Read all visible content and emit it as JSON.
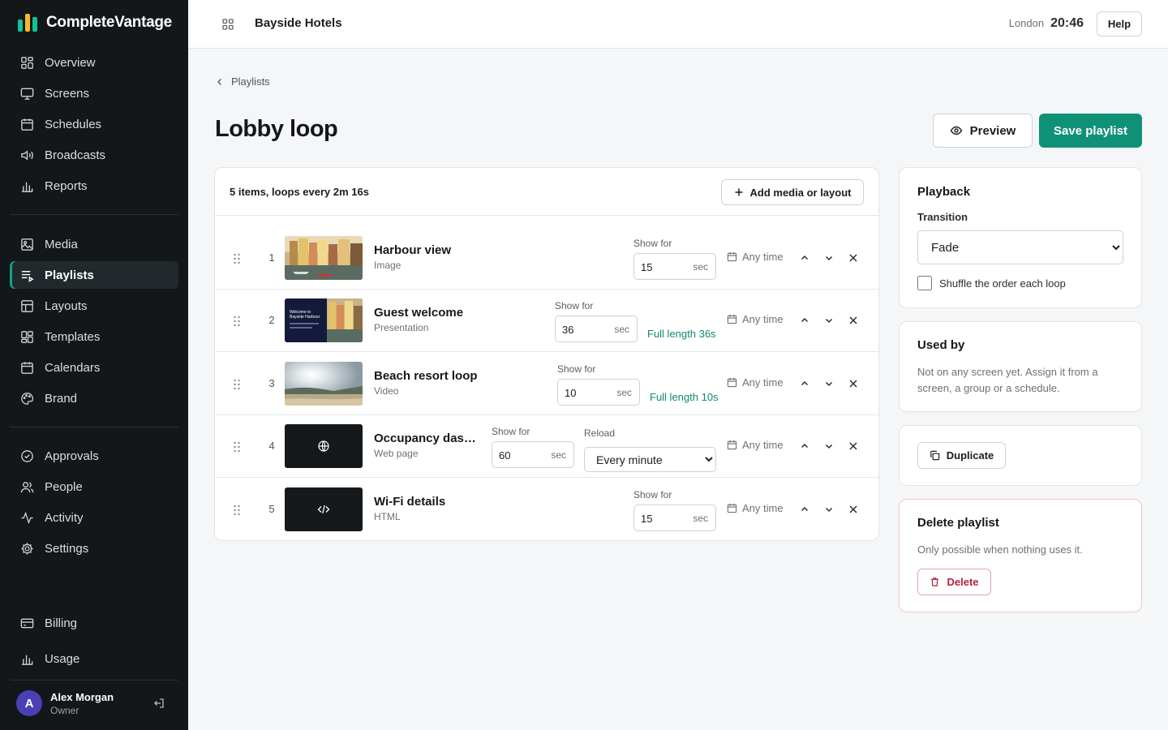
{
  "app": {
    "name": "CompleteVantage",
    "logo_colors": [
      "#12c29a",
      "#f5b82e",
      "#12c29a"
    ]
  },
  "sidebar": {
    "primary": [
      {
        "label": "Overview",
        "icon": "grid-icon"
      },
      {
        "label": "Screens",
        "icon": "monitor-icon"
      },
      {
        "label": "Schedules",
        "icon": "calendar-icon"
      },
      {
        "label": "Broadcasts",
        "icon": "speaker-icon"
      },
      {
        "label": "Reports",
        "icon": "bar-chart-icon"
      }
    ],
    "content": [
      {
        "label": "Media",
        "icon": "image-icon"
      },
      {
        "label": "Playlists",
        "icon": "playlist-icon",
        "active": true
      },
      {
        "label": "Layouts",
        "icon": "layout-icon"
      },
      {
        "label": "Templates",
        "icon": "template-icon"
      },
      {
        "label": "Calendars",
        "icon": "calendar-icon"
      },
      {
        "label": "Brand",
        "icon": "palette-icon"
      }
    ],
    "admin": [
      {
        "label": "Approvals",
        "icon": "check-circle-icon"
      },
      {
        "label": "People",
        "icon": "users-icon"
      },
      {
        "label": "Activity",
        "icon": "activity-icon"
      },
      {
        "label": "Settings",
        "icon": "gear-icon"
      }
    ],
    "billing": [
      {
        "label": "Billing",
        "icon": "credit-card-icon"
      },
      {
        "label": "Usage",
        "icon": "bar-chart-icon"
      }
    ],
    "user": {
      "initial": "A",
      "name": "Alex Morgan",
      "role": "Owner"
    }
  },
  "topbar": {
    "org_name": "Bayside Hotels",
    "city": "London",
    "time": "20:46",
    "help_label": "Help"
  },
  "page": {
    "breadcrumb": "Playlists",
    "title": "Lobby loop",
    "preview_label": "Preview",
    "save_label": "Save playlist"
  },
  "playlist": {
    "summary": "5 items, loops every 2m 16s",
    "add_label": "Add media or layout",
    "show_for_label": "Show for",
    "unit": "sec",
    "any_time": "Any time",
    "reload_label": "Reload",
    "items": [
      {
        "index": "1",
        "title": "Harbour view",
        "type": "Image",
        "seconds": "15",
        "full_length": "",
        "thumb": "harbour"
      },
      {
        "index": "2",
        "title": "Guest welcome",
        "type": "Presentation",
        "seconds": "36",
        "full_length": "Full length 36s",
        "thumb": "welcome",
        "thumb_text": "Welcome to Bayside Harbour"
      },
      {
        "index": "3",
        "title": "Beach resort loop",
        "type": "Video",
        "seconds": "10",
        "full_length": "Full length 10s",
        "thumb": "beach"
      },
      {
        "index": "4",
        "title": "Occupancy dashboard",
        "type": "Web page",
        "seconds": "60",
        "full_length": "",
        "thumb": "globe-icon",
        "reload": "Every minute"
      },
      {
        "index": "5",
        "title": "Wi-Fi details",
        "type": "HTML",
        "seconds": "15",
        "full_length": "",
        "thumb": "code-icon"
      }
    ]
  },
  "playback": {
    "title": "Playback",
    "transition_label": "Transition",
    "transition_value": "Fade",
    "shuffle_label": "Shuffle the order each loop"
  },
  "used_by": {
    "title": "Used by",
    "text": "Not on any screen yet. Assign it from a screen, a group or a schedule."
  },
  "duplicate": {
    "label": "Duplicate"
  },
  "delete": {
    "title": "Delete playlist",
    "text": "Only possible when nothing uses it.",
    "label": "Delete"
  }
}
